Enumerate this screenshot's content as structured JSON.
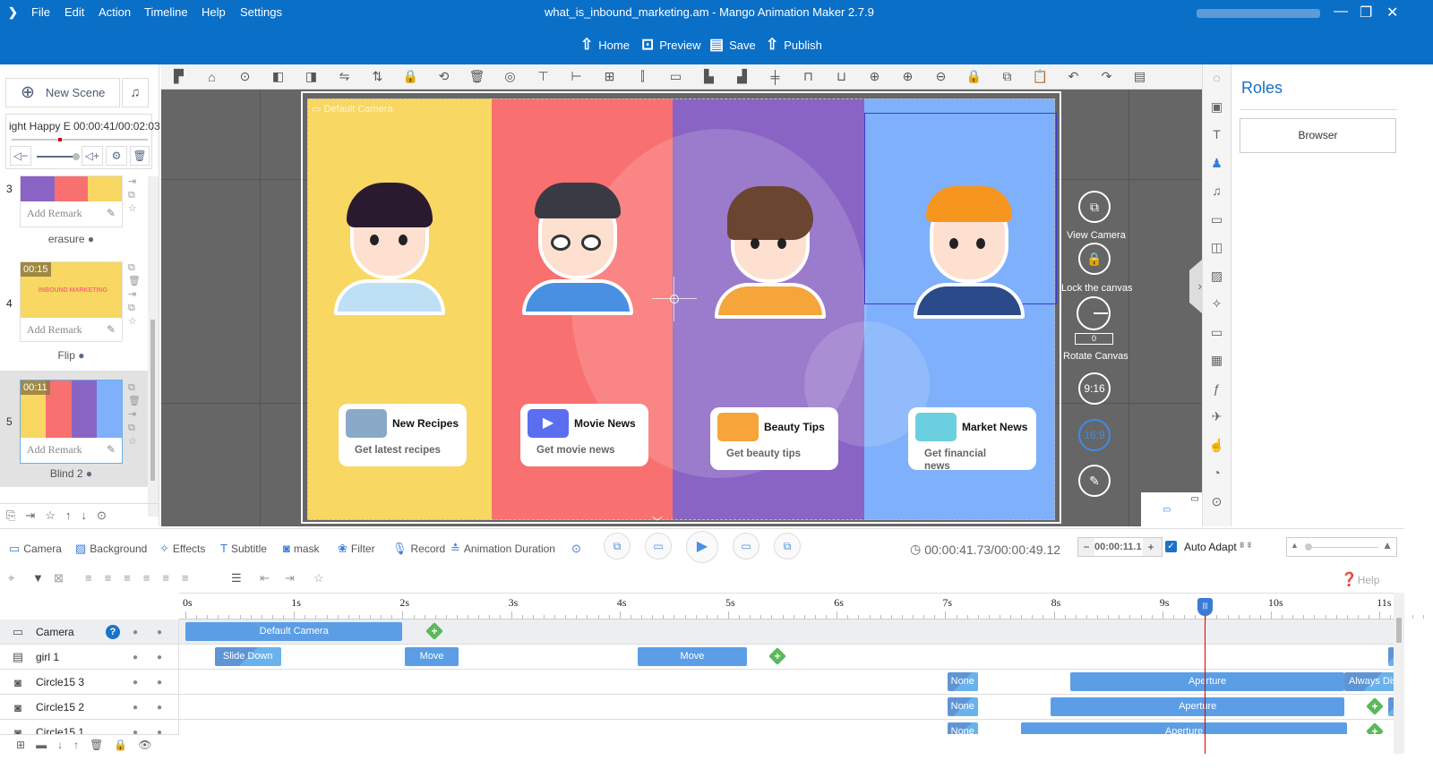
{
  "app": {
    "title": "what_is_inbound_marketing.am - Mango Animation Maker 2.7.9",
    "menu": [
      "File",
      "Edit",
      "Action",
      "Timeline",
      "Help",
      "Settings"
    ],
    "nav": [
      {
        "label": "Home",
        "icon": "home-icon"
      },
      {
        "label": "Preview",
        "icon": "preview-icon"
      },
      {
        "label": "Save",
        "icon": "save-icon"
      },
      {
        "label": "Publish",
        "icon": "publish-icon"
      }
    ],
    "accent": "#0a6fc7"
  },
  "left_panel": {
    "new_scene": "New Scene",
    "music": {
      "title": "ight Happy E",
      "time": "00:00:41/00:02:03"
    },
    "scenes": [
      {
        "num": "3",
        "remark": "Add Remark",
        "transition": "erasure",
        "time": ""
      },
      {
        "num": "4",
        "remark": "Add Remark",
        "transition": "Flip",
        "time": "00:15",
        "thumb_text": "INBOUND MARKETING"
      },
      {
        "num": "5",
        "remark": "Add Remark",
        "transition": "Blind 2",
        "time": "00:11"
      }
    ]
  },
  "canvas": {
    "camera_label": "Default Camera",
    "panel_colors": [
      "#f8d763",
      "#f87070",
      "#8a64c4",
      "#7fb0fb"
    ],
    "cards": [
      {
        "title": "New Recipes",
        "subtitle": "Get latest recipes"
      },
      {
        "title": "Movie News",
        "subtitle": "Get movie news"
      },
      {
        "title": "Beauty Tips",
        "subtitle": "Get beauty tips"
      },
      {
        "title": "Market News",
        "subtitle": "Get financial news"
      }
    ],
    "controls": {
      "view_camera": "View Camera",
      "lock": "Lock the canvas",
      "rotate": "Rotate Canvas",
      "rotate_value": "0",
      "ratio_portrait": "9:16",
      "ratio_landscape": "16:9"
    }
  },
  "props": {
    "title": "Roles",
    "browser": "Browser"
  },
  "bottom_toolbar": {
    "tools": [
      "Camera",
      "Background",
      "Effects",
      "Subtitle",
      "mask",
      "Filter",
      "Record",
      "Animation Duration"
    ],
    "time": "00:00:41.73/00:00:49.12",
    "duration_value": "00:00:11.1",
    "auto_adapt": "Auto Adapt",
    "auto_adapt_checked": true,
    "help": "Help"
  },
  "timeline": {
    "ticks": [
      "0s",
      "1s",
      "2s",
      "3s",
      "4s",
      "5s",
      "6s",
      "7s",
      "8s",
      "9s",
      "10s",
      "11s"
    ],
    "playhead_s": 9.39,
    "rows": [
      {
        "name": "Camera",
        "icon": "camera-icon",
        "blocks": [
          {
            "label": "Default Camera",
            "start": 0,
            "end": 2.0
          }
        ],
        "plus": [
          2.24
        ]
      },
      {
        "name": "girl 1",
        "icon": "svg-icon",
        "blocks": [
          {
            "label": "Slide Down",
            "start": 0.27,
            "end": 0.88,
            "fade": true
          },
          {
            "label": "Move",
            "start": 2.02,
            "end": 2.52
          },
          {
            "label": "Move",
            "start": 4.17,
            "end": 5.17
          },
          {
            "label": "",
            "start": 11.08,
            "end": 11.2,
            "fade": true
          }
        ],
        "plus": [
          5.4
        ]
      },
      {
        "name": "Circle15 3",
        "icon": "shape-icon",
        "blocks": [
          {
            "label": "None",
            "start": 7.02,
            "end": 7.3,
            "fade": true
          },
          {
            "label": "Aperture",
            "start": 8.15,
            "end": 10.68
          },
          {
            "label": "Always Dis",
            "start": 10.68,
            "end": 11.2,
            "fade": true
          }
        ],
        "plus": []
      },
      {
        "name": "Circle15 2",
        "icon": "shape-icon",
        "blocks": [
          {
            "label": "None",
            "start": 7.02,
            "end": 7.3,
            "fade": true
          },
          {
            "label": "Aperture",
            "start": 7.97,
            "end": 10.68
          },
          {
            "label": "",
            "start": 11.08,
            "end": 11.2,
            "fade": true
          }
        ],
        "plus": [
          10.9
        ]
      },
      {
        "name": "Circle15 1",
        "icon": "shape-icon",
        "blocks": [
          {
            "label": "None",
            "start": 7.02,
            "end": 7.3,
            "fade": true
          },
          {
            "label": "Aperture",
            "start": 7.7,
            "end": 10.7
          }
        ],
        "plus": [
          10.9
        ]
      }
    ]
  }
}
